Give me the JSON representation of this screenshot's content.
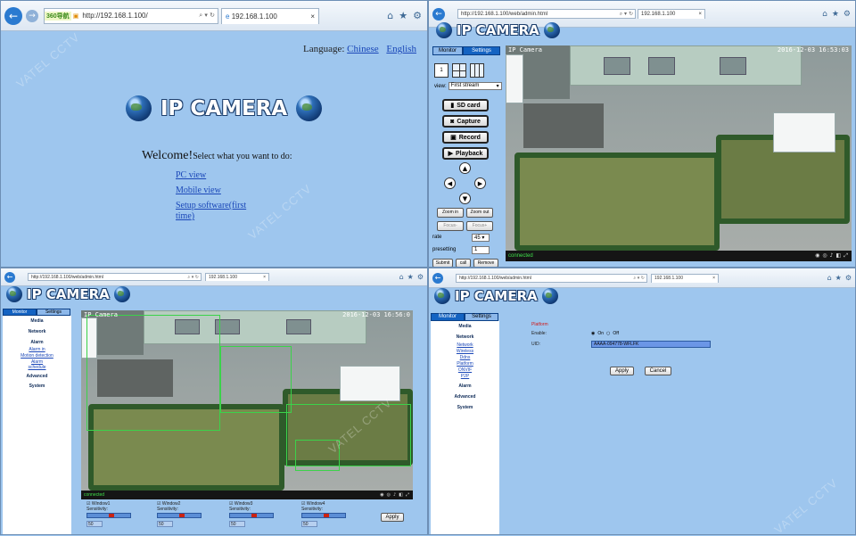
{
  "watermark": "VATEL CCTV",
  "p1": {
    "brand_tag": "360导航",
    "url": "http://192.168.1.100/",
    "tab_title": "192.168.1.100",
    "language_label": "Language:",
    "lang_chinese": "Chinese",
    "lang_english": "English",
    "logo_text": "IP CAMERA",
    "welcome_big": "Welcome!",
    "welcome_small": "Select what you want to do:",
    "links": [
      "PC view",
      "Mobile view",
      "Setup software(first time)"
    ]
  },
  "p2": {
    "url": "http://192.168.1.100/web/admin.html",
    "tab_title": "192.168.1.100",
    "logo_text": "IP CAMERA",
    "tab_monitor": "Monitor",
    "tab_settings": "Settings",
    "layout_one": "1",
    "view_label": "view:",
    "view_value": "First stream",
    "btn_sdcard": "SD card",
    "btn_capture": "Capture",
    "btn_record": "Record",
    "btn_playback": "Playback",
    "zoom_in": "Zoom in",
    "zoom_out": "Zoom out",
    "focus_minus": "Focus-",
    "focus_plus": "Focus+",
    "rate_label": "rate",
    "rate_value": "45",
    "presetting_label": "presetting",
    "presetting_value": "1",
    "btn_submit": "Submit",
    "btn_call": "call",
    "btn_remove": "Remove",
    "cam_title": "IP Camera",
    "cam_time": "2016-12-03 16:53:03",
    "status": "connected"
  },
  "p3": {
    "url": "http://192.168.1.100/web/admin.html",
    "tab_title": "192.168.1.100",
    "logo_text": "IP CAMERA",
    "tab_monitor": "Monitor",
    "tab_settings": "Settings",
    "menu": [
      "Media",
      "Network",
      "Alarm",
      "Advanced",
      "System"
    ],
    "alarm_sub": [
      "Alarm in",
      "Motion detection",
      "Alarm schedule"
    ],
    "cam_title": "IP Camera",
    "cam_time": "2016-12-03 16:56:0",
    "status": "connected",
    "windows": [
      {
        "name": "Window1",
        "sens_label": "Sensitivity:",
        "value": "50"
      },
      {
        "name": "Window2",
        "sens_label": "Sensitivity:",
        "value": "50"
      },
      {
        "name": "Window3",
        "sens_label": "Sensitivity:",
        "value": "50"
      },
      {
        "name": "Window4",
        "sens_label": "Sensitivity:",
        "value": "50"
      }
    ],
    "apply": "Apply"
  },
  "p4": {
    "url": "http://192.168.1.100/web/admin.html",
    "tab_title": "192.168.1.100",
    "logo_text": "IP CAMERA",
    "tab_monitor": "Monitor",
    "tab_settings": "Settings",
    "menu_media": "Media",
    "menu_network": "Network",
    "network_sub": [
      "Network",
      "Wireless",
      "Ddns",
      "Platform",
      "ONVIF",
      "P2P"
    ],
    "menu_alarm": "Alarm",
    "menu_advanced": "Advanced",
    "menu_system": "System",
    "section_title": "Platform",
    "enable_label": "Enable:",
    "on_label": "On",
    "off_label": "Off",
    "uid_label": "UID:",
    "uid_value": "AAAA-094778-WFLFK",
    "apply": "Apply",
    "cancel": "Cancel"
  }
}
